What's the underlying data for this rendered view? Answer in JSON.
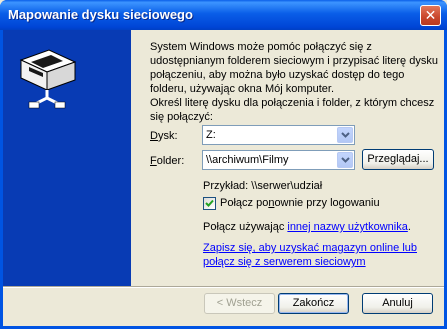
{
  "window": {
    "title": "Mapowanie dysku sieciowego",
    "close_glyph": "✕"
  },
  "intro": {
    "description": "System Windows może pomóc połączyć się z udostępnianym folderem sieciowym i przypisać literę dysku połączeniu, aby można było uzyskać dostęp do tego folderu, używając okna Mój komputer.",
    "instruction": "Określ literę dysku dla połączenia i folder, z którym chcesz się połączyć:"
  },
  "form": {
    "drive_label_accel": "D",
    "drive_label_rest": "ysk:",
    "drive_value": "Z:",
    "folder_label_accel": "F",
    "folder_label_rest": "older:",
    "folder_value": "\\\\archiwum\\Filmy",
    "browse_label": "Przeglądaj...",
    "example": "Przykład: \\\\serwer\\udział",
    "reconnect_label_pre": "Połącz po",
    "reconnect_label_accel": "n",
    "reconnect_label_post": "ownie przy logowaniu",
    "reconnect_checked": true,
    "connect_as_pre": "Połącz używając ",
    "connect_as_link": "innej nazwy użytkownika",
    "connect_as_post": ".",
    "signup_link": "Zapisz się, aby uzyskać magazyn online lub połącz się z serwerem sieciowym"
  },
  "footer": {
    "back_label": "< Wstecz",
    "finish_label": "Zakończ",
    "cancel_label": "Anuluj"
  },
  "colors": {
    "sidebar": "#083bb4",
    "titlebar": "#0054e3",
    "link": "#0000ff"
  },
  "icons": {
    "sidebar": "network-drive-icon",
    "dropdown": "chevron-down-icon",
    "checkbox": "checkmark-icon",
    "close": "close-icon"
  }
}
